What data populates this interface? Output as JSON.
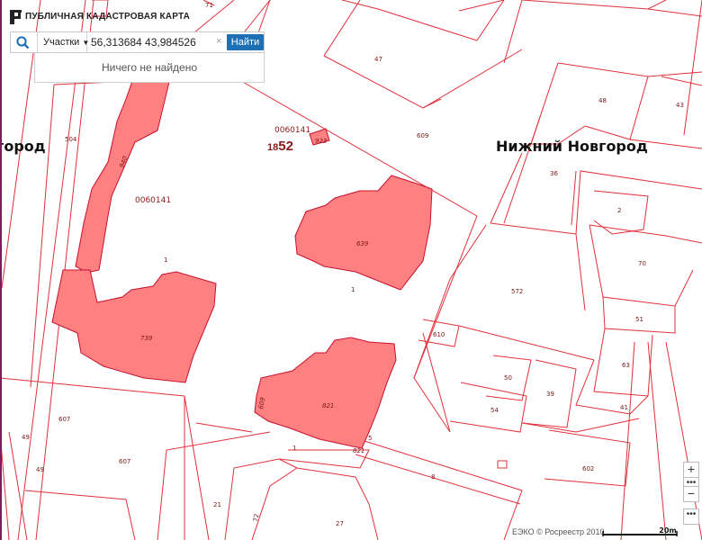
{
  "app": {
    "title": "ПУБЛИЧНАЯ КАДАСТРОВАЯ КАРТА"
  },
  "search": {
    "type_label": "Участки",
    "query": "56,313684 43,984526",
    "clear_glyph": "×",
    "find_label": "Найти",
    "result_message": "Ничего не найдено"
  },
  "controls": {
    "zoom_in": "+",
    "more": "•••",
    "zoom_out": "−",
    "layers": "•••"
  },
  "footer": {
    "attribution": "ЕЭКО © Росреестр 2010",
    "scale_label": "20m"
  },
  "map": {
    "city_labels": [
      "город",
      "Нижний Новгород"
    ],
    "quarter_numbers": [
      "0060141",
      "0060141"
    ],
    "highlight": {
      "prefix": "18",
      "main": "52"
    },
    "parcel_labels": [
      "71",
      "47",
      "504",
      "609",
      "48",
      "43",
      "36",
      "2",
      "70",
      "572",
      "51",
      "610",
      "63",
      "50",
      "39",
      "54",
      "41",
      "607",
      "49",
      "607",
      "49",
      "1",
      "1",
      "1",
      "8",
      "602",
      "21",
      "27",
      "72",
      "5"
    ],
    "building_labels": [
      "940",
      "739",
      "639",
      "821",
      "923",
      "821",
      "609"
    ]
  },
  "colors": {
    "parcel_stroke": "#e0303a",
    "building_fill": "#ff8080",
    "accent": "#1f6fb5",
    "side_bar": "#7a1e5a"
  },
  "icons": [
    "logo-icon",
    "search-icon",
    "caret-down-icon",
    "clear-icon"
  ]
}
